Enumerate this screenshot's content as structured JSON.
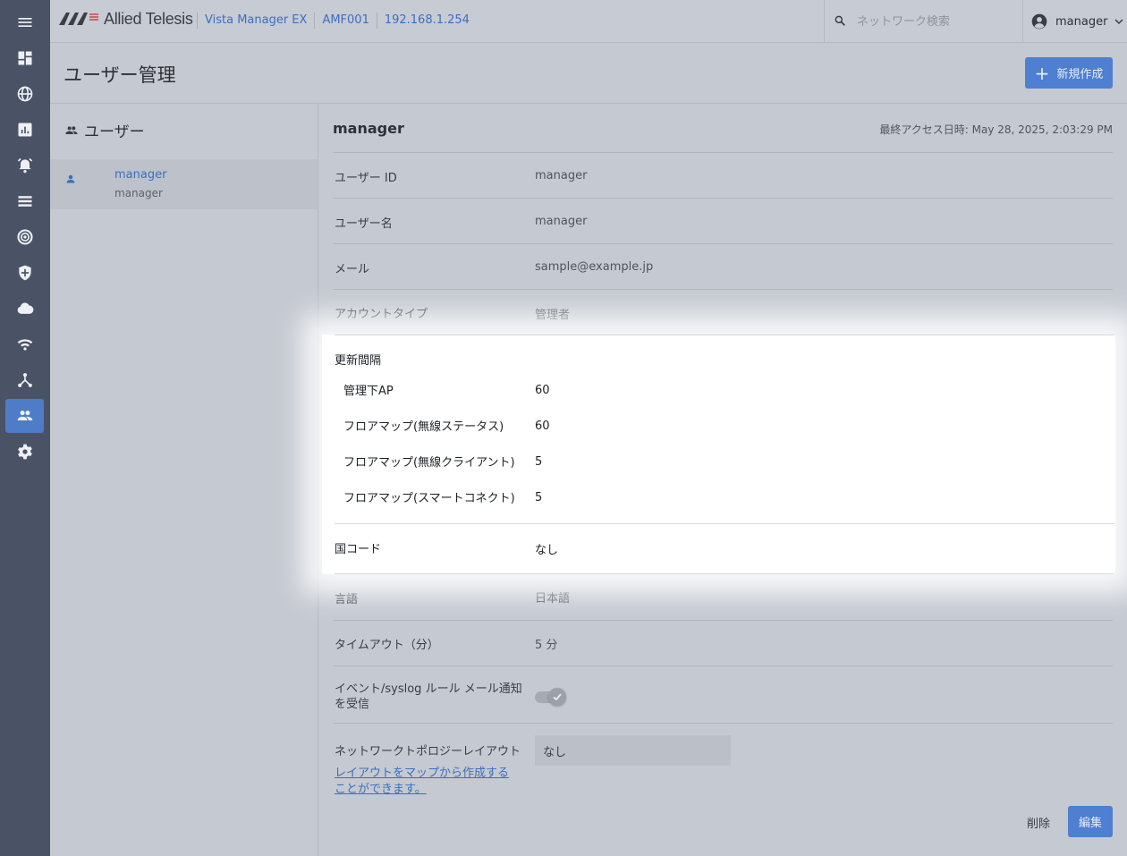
{
  "header": {
    "brand": "Allied Telesis",
    "breadcrumbs": [
      "Vista Manager EX",
      "AMF001",
      "192.168.1.254"
    ],
    "search_placeholder": "ネットワーク検索",
    "user": "manager"
  },
  "sidebar": {
    "items": [
      "menu-icon",
      "dashboard-icon",
      "globe-icon",
      "chart-icon",
      "alarm-icon",
      "list-icon",
      "radar-icon",
      "shield-icon",
      "cloud-icon",
      "wifi-icon",
      "topology-icon",
      "users-icon",
      "settings-icon"
    ],
    "active": "users-icon"
  },
  "page": {
    "title": "ユーザー管理",
    "new_button": "新規作成"
  },
  "user_list": {
    "title": "ユーザー",
    "items": [
      {
        "primary": "manager",
        "secondary": "manager"
      }
    ]
  },
  "detail": {
    "name": "manager",
    "last_access": "最終アクセス日時: May 28, 2025, 2:03:29 PM",
    "fields": {
      "user_id": {
        "label": "ユーザー ID",
        "value": "manager"
      },
      "user_name": {
        "label": "ユーザー名",
        "value": "manager"
      },
      "email": {
        "label": "メール",
        "value": "sample@example.jp"
      },
      "account_type": {
        "label": "アカウントタイプ",
        "value": "管理者"
      },
      "refresh_interval": {
        "label": "更新間隔",
        "rows": [
          {
            "label": "管理下AP",
            "value": "60"
          },
          {
            "label": "フロアマップ(無線ステータス)",
            "value": "60"
          },
          {
            "label": "フロアマップ(無線クライアント)",
            "value": "5"
          },
          {
            "label": "フロアマップ(スマートコネクト)",
            "value": "5"
          }
        ]
      },
      "country_code": {
        "label": "国コード",
        "value": "なし"
      },
      "language": {
        "label": "言語",
        "value": "日本語"
      },
      "timeout": {
        "label": "タイムアウト（分）",
        "value": "5 分"
      },
      "event_mail": {
        "label_line1": "イベント/syslog ルール メール通知",
        "label_line2": "を受信",
        "enabled": true
      },
      "topology_layout": {
        "label": "ネットワークトポロジーレイアウト",
        "value": "なし",
        "link_text": "レイアウトをマップから作成することができます。"
      }
    },
    "delete_button": "削除",
    "edit_button": "編集"
  },
  "colors": {
    "accent": "#4e7fd0",
    "rail": "#4a5265",
    "link": "#3a6fbf"
  }
}
